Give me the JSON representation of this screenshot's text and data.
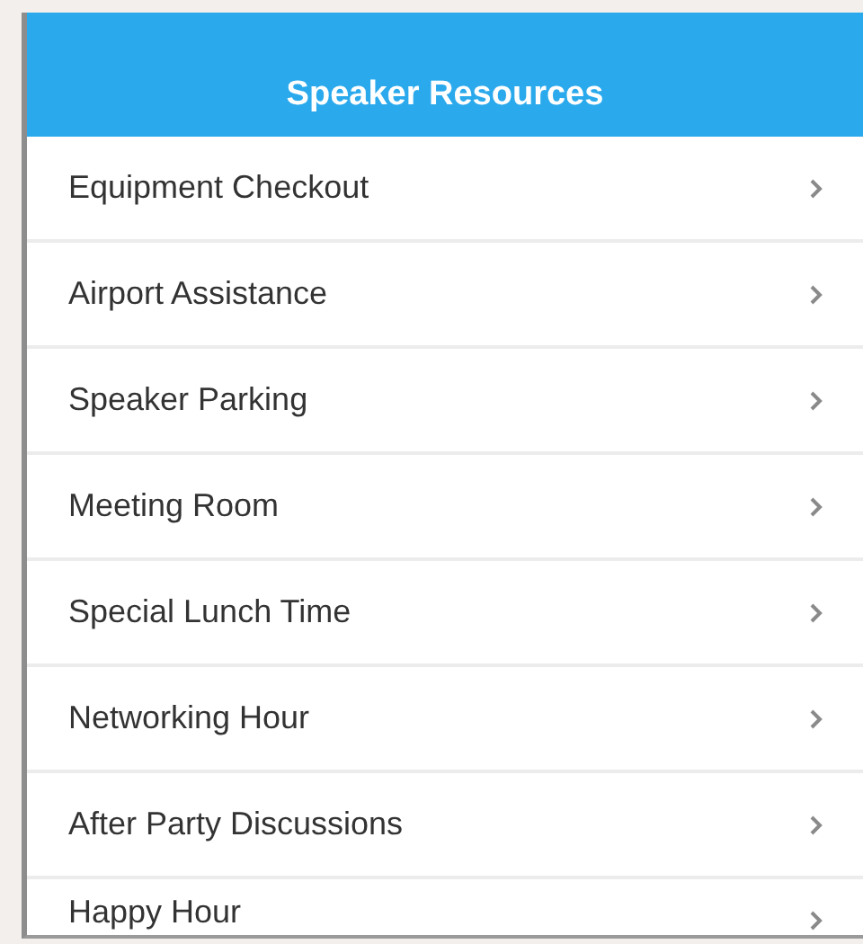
{
  "header": {
    "title": "Speaker Resources"
  },
  "items": [
    {
      "label": "Equipment Checkout"
    },
    {
      "label": "Airport Assistance"
    },
    {
      "label": "Speaker Parking"
    },
    {
      "label": "Meeting Room"
    },
    {
      "label": "Special Lunch Time"
    },
    {
      "label": "Networking Hour"
    },
    {
      "label": "After Party Discussions"
    },
    {
      "label": "Happy Hour"
    }
  ]
}
